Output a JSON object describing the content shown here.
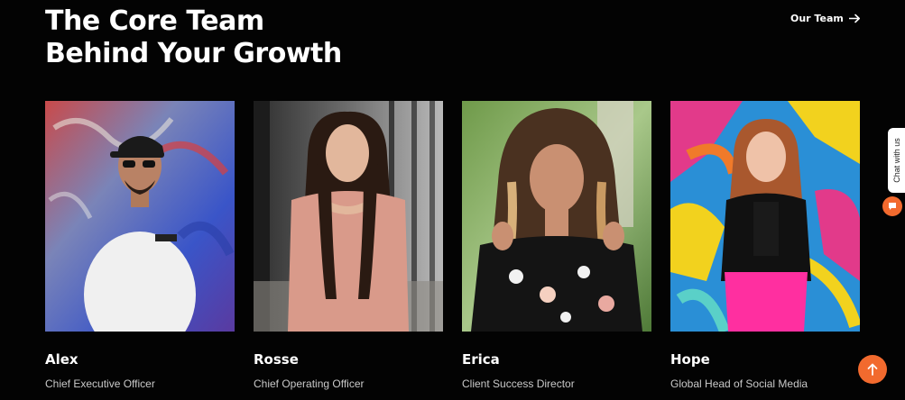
{
  "heading": {
    "line1": "The Core Team",
    "line2": "Behind Your Growth"
  },
  "header_link": {
    "label": "Our Team",
    "icon": "arrow-right-icon"
  },
  "team": [
    {
      "name": "Alex",
      "role": "Chief Executive Officer"
    },
    {
      "name": "Rosse",
      "role": "Chief Operating Officer"
    },
    {
      "name": "Erica",
      "role": "Client Success Director"
    },
    {
      "name": "Hope",
      "role": "Global Head of Social Media"
    }
  ],
  "chat_widget": {
    "label": "Chat with us",
    "icon": "chat-bubble-icon"
  },
  "scroll_top": {
    "icon": "arrow-up-icon"
  },
  "colors": {
    "background": "#030303",
    "accent": "#f26a2e",
    "text": "#ffffff",
    "muted_text": "#c9c9c9"
  }
}
